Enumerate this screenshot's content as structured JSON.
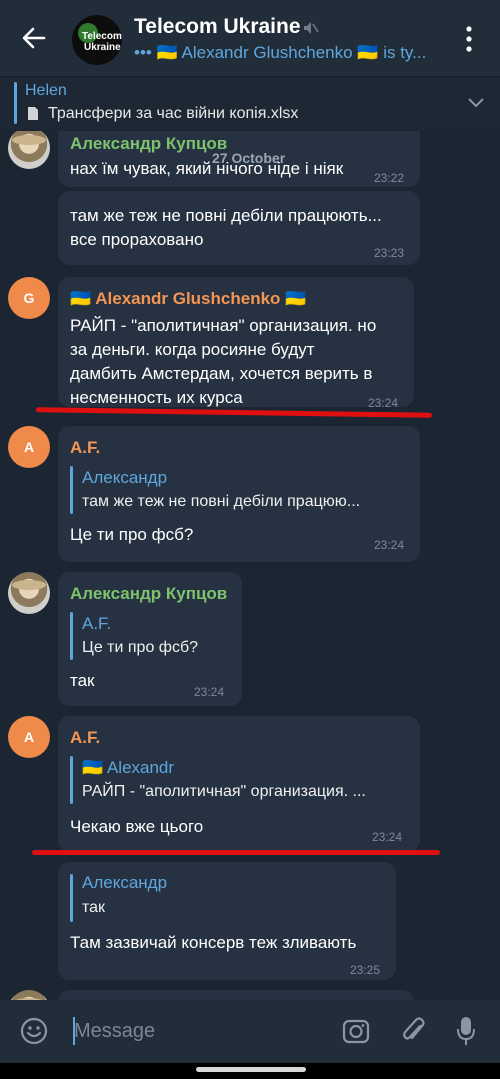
{
  "header": {
    "title": "Telecom Ukraine",
    "avatar_line1": "Telecom",
    "avatar_line2": "Ukraine",
    "status": "••• 🇺🇦 Alexandr Glushchenko 🇺🇦 is ty..."
  },
  "pinned": {
    "name": "Helen",
    "file": "Трансфери за час війни копія.xlsx"
  },
  "date_badge": "27 October",
  "messages": [
    {
      "sender": "Александр Купцов",
      "text": "нах їм чувак, який нічого ніде і ніяк",
      "time": "23:22"
    },
    {
      "text_1": "там же теж не повні дебіли працюють...",
      "text_2": "все прораховано",
      "time": "23:23"
    },
    {
      "avatar": "G",
      "sender": "🇺🇦 Alexandr Glushchenko 🇺🇦",
      "text_1": "РАЙП - \"аполитичная\" организация. но",
      "text_2": "за деньги. когда росияне будут",
      "text_3": "дамбить Амстердам, хочется верить в",
      "text_4": "несменность их курса",
      "time": "23:24"
    },
    {
      "avatar": "A",
      "sender": "A.F.",
      "reply_name": "Александр",
      "reply_text": "там же теж не повні дебіли працюю...",
      "text": "Це ти про фсб?",
      "time": "23:24"
    },
    {
      "sender": "Александр Купцов",
      "reply_name": "A.F.",
      "reply_text": "Це ти про фсб?",
      "text": "так",
      "time": "23:24"
    },
    {
      "avatar": "A",
      "sender": "A.F.",
      "reply_name": "🇺🇦 Alexandr",
      "reply_text": "РАЙП - \"аполитичная\" организация. ...",
      "text": "Чекаю вже цього",
      "time": "23:24"
    },
    {
      "reply_name": "Александр",
      "reply_text": "так",
      "text": "Там зазвичай консерв теж зливають",
      "time": "23:25"
    }
  ],
  "input": {
    "placeholder": "Message"
  },
  "colors": {
    "accent": "#5fa6de",
    "background": "#1c2633",
    "bubble": "#263241",
    "highlight": "#e01010"
  }
}
